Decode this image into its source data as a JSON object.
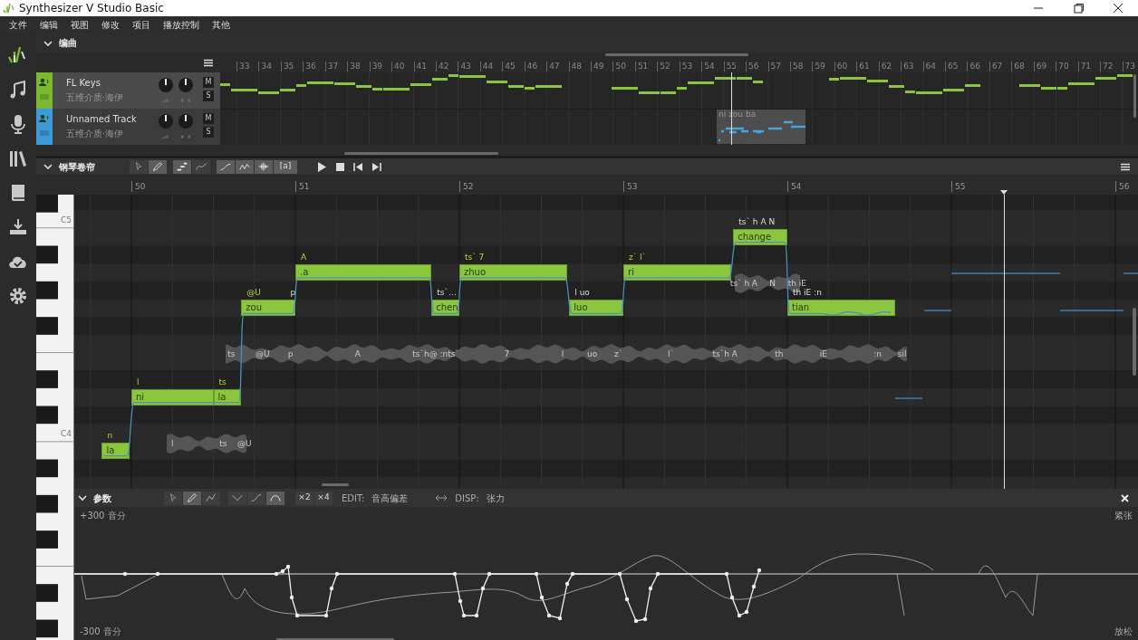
{
  "window": {
    "title": "Synthesizer V Studio Basic"
  },
  "menu": [
    "文件",
    "编辑",
    "视图",
    "修改",
    "项目",
    "播放控制",
    "其他"
  ],
  "arrangement": {
    "title": "编曲",
    "expanded": true,
    "ruler": [
      "33",
      "34",
      "35",
      "36",
      "37",
      "38",
      "39",
      "40",
      "41",
      "42",
      "43",
      "44",
      "45",
      "46",
      "47",
      "48",
      "49",
      "50",
      "51",
      "52",
      "53",
      "54",
      "55",
      "56",
      "57",
      "58",
      "59",
      "60",
      "61",
      "62",
      "63",
      "64",
      "65",
      "66",
      "67",
      "68",
      "69",
      "70",
      "71",
      "72",
      "73"
    ],
    "tracks": [
      {
        "name": "FL Keys",
        "voice": "五维介质·海伊",
        "color": "#7ab92f",
        "selected": true,
        "buttons": [
          "M",
          "S"
        ]
      },
      {
        "name": "Unnamed Track",
        "voice": "五维介质·海伊",
        "color": "#3d9ad9",
        "selected": false,
        "buttons": [
          "M",
          "S"
        ]
      }
    ],
    "clip": {
      "label": "ni zou ba"
    }
  },
  "piano_roll": {
    "title": "钢琴卷帘",
    "expanded": true,
    "tools": [
      {
        "kind": "select",
        "selected": false
      },
      {
        "kind": "pen",
        "selected": true
      },
      {
        "kind": "notes",
        "selected": true
      },
      {
        "kind": "curve",
        "selected": false
      },
      {
        "kind": "pitch",
        "selected": true
      },
      {
        "kind": "vibrato",
        "selected": true
      },
      {
        "kind": "waveform",
        "selected": true
      },
      {
        "kind": "phonemes",
        "label": "[a]",
        "selected": true
      }
    ],
    "ruler": [
      "50",
      "51",
      "52",
      "53",
      "54",
      "55",
      "56"
    ],
    "keys": [
      "C5",
      "C4"
    ],
    "notes": [
      {
        "lyric": "la",
        "phonemes": "n",
        "edited": true
      },
      {
        "lyric": "ni",
        "phonemes": "l",
        "edited": true
      },
      {
        "lyric": "la",
        "phonemes": "ts",
        "edited": true
      },
      {
        "lyric": "zou",
        "phonemes": "@U",
        "edited": true
      },
      {
        "lyric": ".a",
        "phonemes": "A",
        "edited": true
      },
      {
        "lyric": "chen",
        "phonemes": "ts`…",
        "edited": false
      },
      {
        "lyric": "zhuo",
        "phonemes": "ts` 7",
        "edited": true
      },
      {
        "lyric": "luo",
        "phonemes": "l uo",
        "edited": false
      },
      {
        "lyric": "ri",
        "phonemes": "z` l`",
        "edited": true
      },
      {
        "lyric": "change",
        "phonemes": "ts` h A N",
        "edited": false
      },
      {
        "lyric": "tian",
        "phonemes": "th iE :n",
        "edited": false
      }
    ],
    "labels": [
      "p"
    ],
    "waveforms": [
      {
        "labels": [
          "ts",
          "@U",
          "p",
          "A",
          "ts`h@",
          ":nts`",
          "7",
          "l",
          "uo",
          "z`",
          "l`",
          "ts`h A",
          "th",
          "iE",
          ":n",
          "sil"
        ]
      },
      {
        "labels": [
          "ts` h",
          "A",
          "N",
          "th iE"
        ]
      },
      {
        "labels": [
          "l",
          "ts",
          "@U"
        ]
      }
    ]
  },
  "parameters": {
    "title": "参数",
    "expanded": true,
    "tools": [
      {
        "kind": "select",
        "selected": false
      },
      {
        "kind": "pen",
        "selected": true
      },
      {
        "kind": "sketch",
        "selected": false
      },
      {
        "kind": "dip",
        "selected": false
      },
      {
        "kind": "rise",
        "selected": false
      },
      {
        "kind": "hump",
        "selected": true
      }
    ],
    "multipliers": [
      "×2",
      "×4"
    ],
    "edit_label": "EDIT:",
    "edit_value": "音高偏差",
    "disp_label": "DISP:",
    "disp_value": "张力",
    "top_label": "+300 音分",
    "bottom_label": "-300 音分",
    "top_right": "紧张",
    "bottom_right": "放松"
  }
}
